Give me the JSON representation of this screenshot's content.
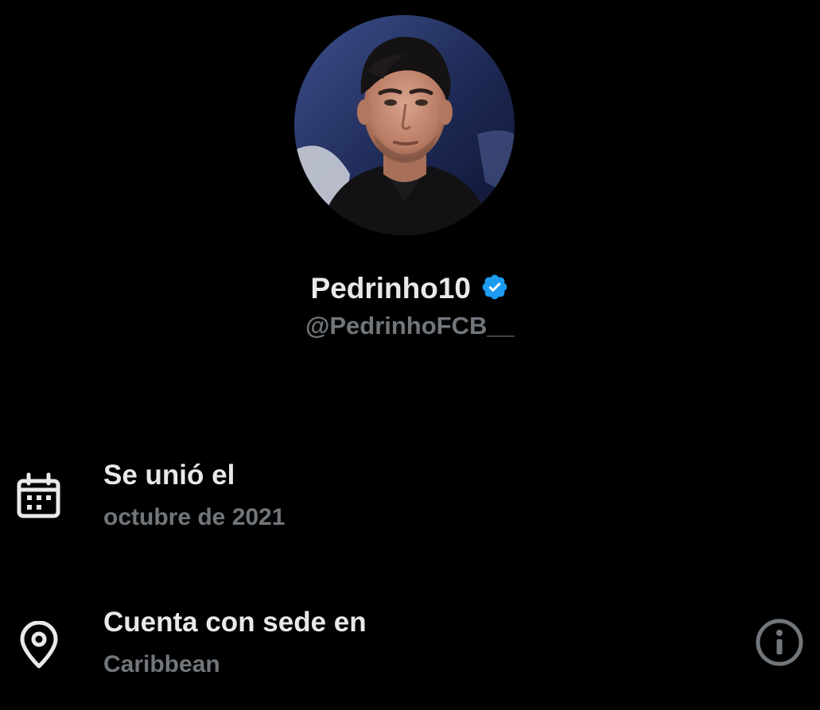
{
  "profile": {
    "display_name": "Pedrinho10",
    "handle": "@PedrinhoFCB__",
    "verified": true,
    "verified_color": "#1d9bf0"
  },
  "about": {
    "joined": {
      "icon": "calendar-icon",
      "title": "Se unió el",
      "value": "octubre de 2021"
    },
    "based_in": {
      "icon": "location-pin-icon",
      "title": "Cuenta con sede en",
      "value": "Caribbean",
      "info_icon": "info-icon"
    }
  },
  "colors": {
    "background": "#000000",
    "primary_text": "#e7e9ea",
    "secondary_text": "#71767b",
    "icon": "#e7e9ea"
  }
}
